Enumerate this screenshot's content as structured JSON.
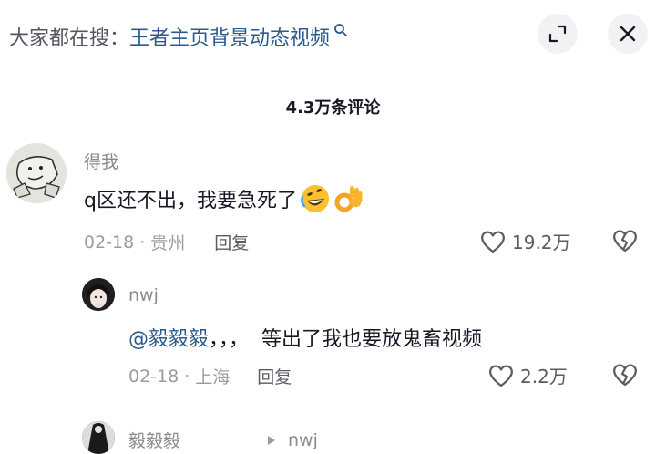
{
  "search": {
    "prefix": "大家都在搜：",
    "query": "王者主页背景动态视频"
  },
  "header": {
    "comment_count": "4.3万条评论"
  },
  "comments": [
    {
      "username": "得我",
      "text": "q区还不出，我要急死了",
      "emoji": [
        "rofl-emoji",
        "ok-hand-emoji"
      ],
      "date": "02-18",
      "location": "贵州",
      "reply_label": "回复",
      "likes": "19.2万"
    }
  ],
  "replies": [
    {
      "username": "nwj",
      "mention": "@毅毅毅",
      "text": "，，，  等出了我也要放鬼畜视频",
      "date": "02-18",
      "location": "上海",
      "reply_label": "回复",
      "likes": "2.2万"
    },
    {
      "username": "毅毅毅",
      "reply_to": "nwj"
    }
  ],
  "icons": {
    "expand": "expand-icon",
    "close": "close-icon",
    "like": "heart-icon",
    "dislike": "broken-heart-icon",
    "search": "search-icon",
    "reply_arrow": "play-arrow-icon"
  },
  "colors": {
    "link": "#2c5a8c",
    "muted": "#9a9ba1",
    "text": "#161823"
  }
}
